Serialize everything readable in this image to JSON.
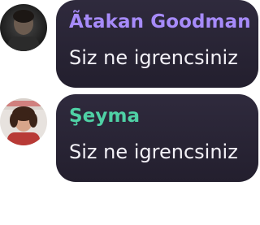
{
  "messages": [
    {
      "author": "Ãtakan Goodman",
      "author_color": "#a78bfa",
      "text": "Siz ne igrencsiniz",
      "avatar": "dark-portrait-avatar"
    },
    {
      "author": "Şeyma",
      "author_color": "#4fd1a5",
      "text": "Siz ne igrencsiniz",
      "avatar": "red-shirt-portrait-avatar"
    }
  ],
  "colors": {
    "bubble_background": "#2a2536",
    "message_text": "#f3f1f7"
  }
}
